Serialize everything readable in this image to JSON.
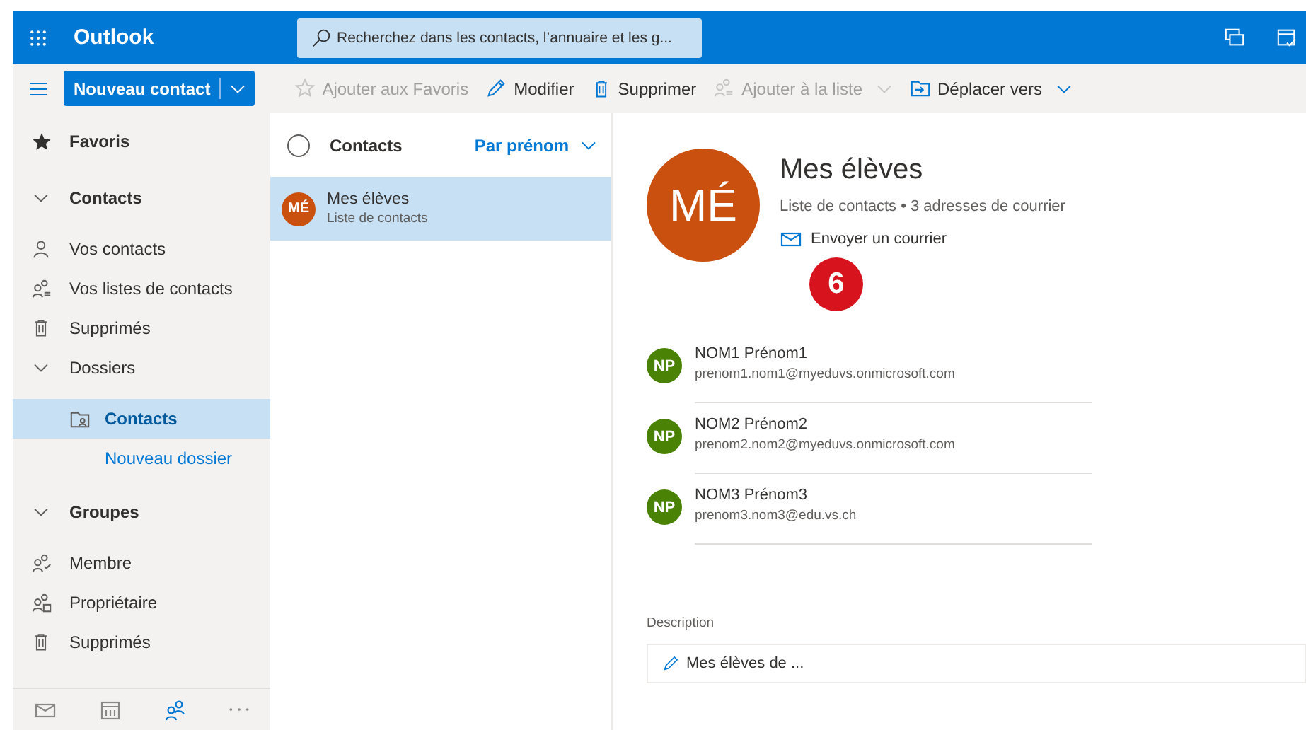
{
  "app_bar": {
    "title": "Outlook",
    "search": {
      "placeholder": "Recherchez dans les contacts, l’annuaire et les g..."
    }
  },
  "toolbar": {
    "new_button": {
      "label": "Nouveau contact"
    },
    "actions": [
      {
        "kind": "favorite",
        "label": "Ajouter aux Favoris",
        "disabled": true,
        "dropdown": false
      },
      {
        "kind": "edit",
        "label": "Modifier",
        "disabled": false,
        "dropdown": false
      },
      {
        "kind": "delete",
        "label": "Supprimer",
        "disabled": false,
        "dropdown": false
      },
      {
        "kind": "addlist",
        "label": "Ajouter à la liste",
        "disabled": true,
        "dropdown": true
      },
      {
        "kind": "move",
        "label": "Déplacer vers",
        "disabled": false,
        "dropdown": true
      }
    ]
  },
  "sidebar": {
    "sections": [
      {
        "kind": "favorites",
        "label": "Favoris"
      },
      {
        "kind": "group",
        "label": "Contacts",
        "expanded": true,
        "items": [
          {
            "kind": "person",
            "label": "Vos contacts",
            "selected": false
          },
          {
            "kind": "lists",
            "label": "Vos listes de contacts",
            "selected": false
          },
          {
            "kind": "trash",
            "label": "Supprimés",
            "selected": false
          },
          {
            "kind": "folders",
            "label": "Dossiers",
            "selected": false,
            "expanded": true,
            "children": [
              {
                "kind": "folder",
                "label": "Contacts",
                "selected": true
              },
              {
                "kind": "link",
                "label": "Nouveau dossier",
                "selected": false
              }
            ]
          }
        ]
      },
      {
        "kind": "group",
        "label": "Groupes",
        "expanded": true,
        "items": [
          {
            "kind": "member",
            "label": "Membre",
            "selected": false
          },
          {
            "kind": "owner",
            "label": "Propriétaire",
            "selected": false
          },
          {
            "kind": "trash",
            "label": "Supprimés",
            "selected": false
          }
        ]
      }
    ],
    "bottom_nav": [
      {
        "kind": "mail",
        "selected": false
      },
      {
        "kind": "calendar",
        "selected": false
      },
      {
        "kind": "people",
        "selected": true
      },
      {
        "kind": "more",
        "selected": false
      }
    ]
  },
  "list": {
    "select_all": {
      "checked": false
    },
    "title": "Contacts",
    "sort": "Par prénom",
    "items": [
      {
        "initials": "MÉ",
        "name": "Mes élèves",
        "subtitle": "Liste de contacts",
        "color": "#ca5010",
        "selected": true
      }
    ]
  },
  "detail": {
    "initials": "MÉ",
    "color": "#ca5010",
    "name": "Mes élèves",
    "summary": "Liste de contacts • 3 adresses de courrier",
    "action": "Envoyer un courrier",
    "callout": "6",
    "members": [
      {
        "initials": "NP",
        "name": "NOM1 Prénom1",
        "email": "prenom1.nom1@myeduvs.onmicrosoft.com",
        "color": "#498205"
      },
      {
        "initials": "NP",
        "name": "NOM2 Prénom2",
        "email": "prenom2.nom2@myeduvs.onmicrosoft.com",
        "color": "#498205"
      },
      {
        "initials": "NP",
        "name": "NOM3 Prénom3",
        "email": "prenom3.nom3@edu.vs.ch",
        "color": "#498205"
      }
    ],
    "description": {
      "label": "Description",
      "value": "Mes élèves de ..."
    }
  }
}
